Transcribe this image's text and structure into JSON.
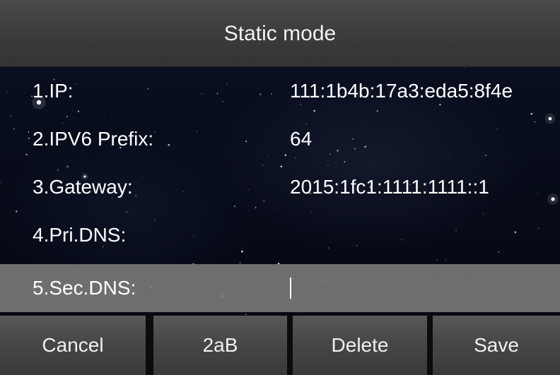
{
  "title": "Static mode",
  "fields": [
    {
      "label": "1.IP:",
      "value": "111:1b4b:17a3:eda5:8f4e"
    },
    {
      "label": "2.IPV6 Prefix:",
      "value": "64"
    },
    {
      "label": "3.Gateway:",
      "value": "2015:1fc1:1111:1111::1"
    },
    {
      "label": "4.Pri.DNS:",
      "value": ""
    },
    {
      "label": "5.Sec.DNS:",
      "value": ""
    }
  ],
  "selected_field": "5.Sec.DNS:",
  "softkeys": {
    "cancel": "Cancel",
    "input_mode": "2aB",
    "delete": "Delete",
    "save": "Save"
  },
  "colors": {
    "title_bar": "#3c3c3c",
    "selected_row": "#767876",
    "softkey": "#474747",
    "background": "#070b18"
  }
}
